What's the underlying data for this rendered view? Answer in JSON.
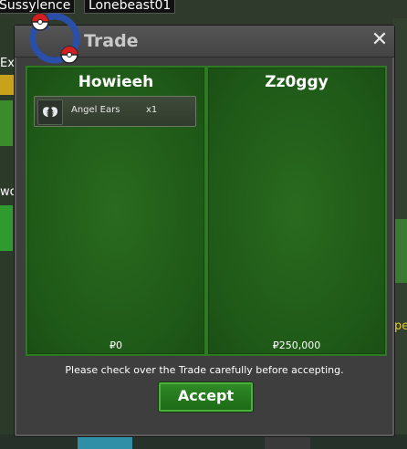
{
  "background": {
    "player_names": [
      "Sussylence",
      "Lonebeast01"
    ],
    "side_text": [
      "Ex",
      "wo",
      "pe"
    ]
  },
  "window": {
    "title": "Trade",
    "close_symbol": "✕"
  },
  "left_panel": {
    "player": "Howieeh",
    "items": [
      {
        "name": "Angel Ears",
        "qty": "x1",
        "icon": "angel-wings-icon"
      }
    ],
    "money": "₽0"
  },
  "right_panel": {
    "player": "Zz0ggy",
    "items": [],
    "money": "₽250,000"
  },
  "notice": "Please check over the Trade carefully before accepting.",
  "accept_label": "Accept",
  "colors": {
    "panel_green": "#1f5a18",
    "panel_border": "#2d7a22",
    "window_bg": "#3e3e3e",
    "accept_green": "#2e8a25"
  }
}
